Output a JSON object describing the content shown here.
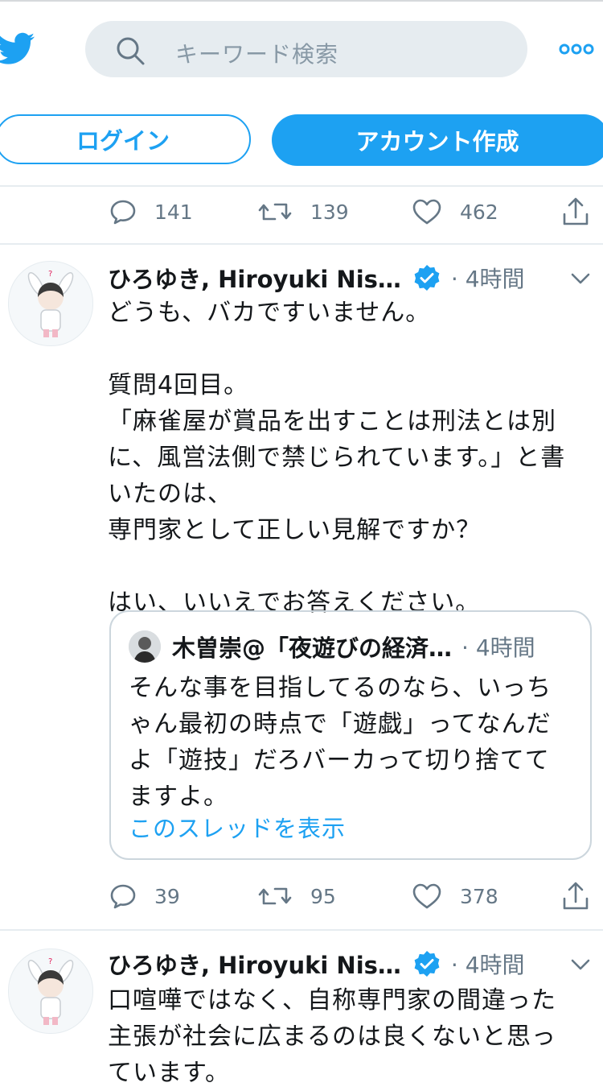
{
  "colors": {
    "brand": "#1DA1F2",
    "muted": "#657786",
    "search_bg": "#E6ECF0"
  },
  "header": {
    "logo": "twitter-bird-icon",
    "search": {
      "placeholder": "キーワード検索",
      "icon": "search-icon"
    },
    "more_icon": "more-icon",
    "login_label": "ログイン",
    "create_account_label": "アカウント作成"
  },
  "tweets": [
    {
      "stats": {
        "replies": "141",
        "retweets": "139",
        "likes": "462"
      }
    },
    {
      "author": "ひろゆき, Hiroyuki Nis…",
      "time": "· 4時間",
      "text": "どうも、バカですいません。\n\n質問4回目。\n「麻雀屋が賞品を出すことは刑法とは別\nに、風営法側で禁じられています。」と書\nいたのは、\n専門家として正しい見解ですか？\n\nはい、いいえでお答えください。",
      "quote": {
        "author": "木曽崇@「夜遊びの経済…",
        "time": "· 4時間",
        "text": "そんな事を目指してるのなら、いっち\nゃん最初の時点で「遊戯」ってなんだ\nよ「遊技」だろバーカって切り捨てて\nますよ。",
        "link": "このスレッドを表示"
      },
      "stats": {
        "replies": "39",
        "retweets": "95",
        "likes": "378"
      }
    },
    {
      "author": "ひろゆき, Hiroyuki Nis…",
      "time": "· 4時間",
      "text": "口喧嘩ではなく、自称専門家の間違った\n主張が社会に広まるのは良くないと思っ\nています。"
    }
  ]
}
